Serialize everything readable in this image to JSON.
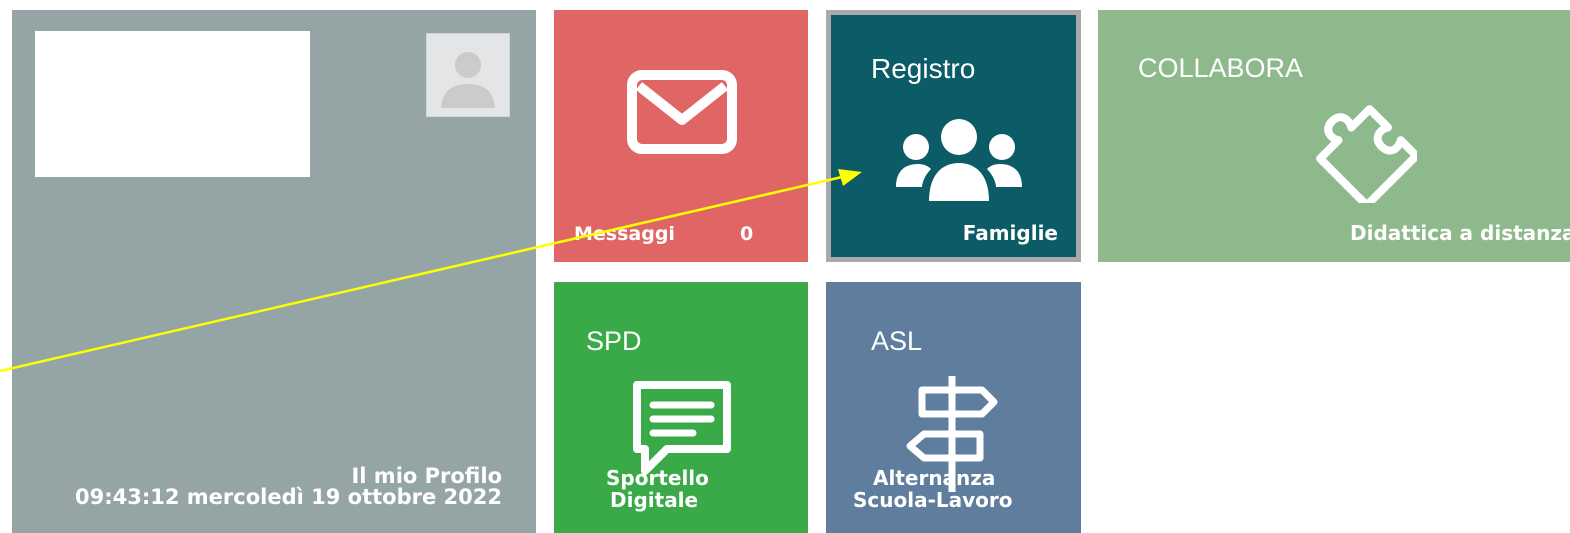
{
  "profile": {
    "label": "Il mio Profilo",
    "datetime": "09:43:12 mercoledì 19 ottobre 2022",
    "avatar_icon": "user-silhouette-icon"
  },
  "tiles": {
    "messaggi": {
      "label": "Messaggi",
      "count": "0",
      "icon": "envelope-icon",
      "color": "#e06666"
    },
    "registro": {
      "title": "Registro",
      "label": "Famiglie",
      "icon": "users-group-icon",
      "color": "#0b5c66"
    },
    "collabora": {
      "title": "COLLABORA",
      "label": "Didattica a distanza",
      "icon": "puzzle-piece-icon",
      "color": "#8eb98c"
    },
    "spd": {
      "title": "SPD",
      "label_line1": "Sportello",
      "label_line2": "Digitale",
      "icon": "chat-bubble-icon",
      "color": "#3aaa48"
    },
    "asl": {
      "title": "ASL",
      "label_line1": "Alternanza",
      "label_line2": "Scuola-Lavoro",
      "icon": "signpost-icon",
      "color": "#5f7d9c"
    }
  },
  "annotation": {
    "color": "#ffff00",
    "icon": "arrow-annotation"
  }
}
